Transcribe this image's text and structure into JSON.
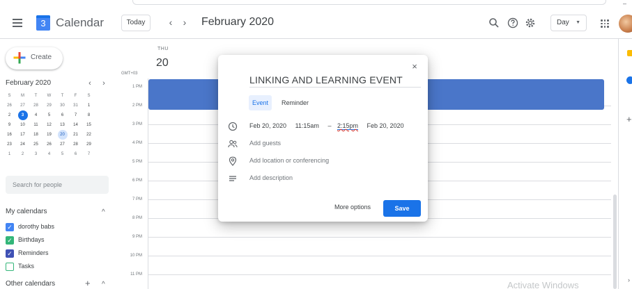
{
  "header": {
    "logo_day": "3",
    "app_title": "Calendar",
    "today_label": "Today",
    "prev_glyph": "‹",
    "next_glyph": "›",
    "date_title": "February 2020",
    "view_label": "Day",
    "view_caret": "▼",
    "icons": [
      "menu-icon",
      "search-icon",
      "help-icon",
      "gear-icon",
      "apps-icon",
      "avatar"
    ]
  },
  "sidebar": {
    "create_label": "Create",
    "mini_month": "February 2020",
    "mini_prev": "‹",
    "mini_next": "›",
    "weekday_heads": [
      "S",
      "M",
      "T",
      "W",
      "T",
      "F",
      "S"
    ],
    "weeks": [
      [
        "26",
        "27",
        "28",
        "29",
        "30",
        "31",
        "1"
      ],
      [
        "2",
        "3",
        "4",
        "5",
        "6",
        "7",
        "8"
      ],
      [
        "9",
        "10",
        "11",
        "12",
        "13",
        "14",
        "15"
      ],
      [
        "16",
        "17",
        "18",
        "19",
        "20",
        "21",
        "22"
      ],
      [
        "23",
        "24",
        "25",
        "26",
        "27",
        "28",
        "29"
      ],
      [
        "1",
        "2",
        "3",
        "4",
        "5",
        "6",
        "7"
      ]
    ],
    "today_date": "3",
    "selected_date": "20",
    "search_people_placeholder": "Search for people",
    "my_calendars_label": "My calendars",
    "my_calendars": [
      {
        "name": "dorothy babs",
        "checked": true,
        "color": "#4285f4"
      },
      {
        "name": "Birthdays",
        "checked": true,
        "color": "#33b679"
      },
      {
        "name": "Reminders",
        "checked": true,
        "color": "#3f51b5"
      },
      {
        "name": "Tasks",
        "checked": false,
        "color": "#33b679"
      }
    ],
    "other_calendars_label": "Other calendars",
    "other_plus": "+",
    "caret_up": "^"
  },
  "day_view": {
    "weekday": "THU",
    "day_number": "20",
    "timezone": "GMT+03",
    "hours": [
      "1 PM",
      "2 PM",
      "3 PM",
      "4 PM",
      "5 PM",
      "6 PM",
      "7 PM",
      "8 PM",
      "9 PM",
      "10 PM",
      "11 PM"
    ],
    "event_color": "#4a76c9"
  },
  "dialog": {
    "close_glyph": "×",
    "title": "LINKING AND LEARNING EVENT",
    "tab_event": "Event",
    "tab_reminder": "Reminder",
    "start_date": "Feb 20, 2020",
    "start_time": "11:15am",
    "dash": "–",
    "end_time": "2:15pm",
    "end_date": "Feb 20, 2020",
    "guests_placeholder": "Add guests",
    "location_placeholder": "Add location or conferencing",
    "description_placeholder": "Add description",
    "more_options_label": "More options",
    "save_label": "Save"
  },
  "watermark": "Activate Windows",
  "colors": {
    "accent": "#1a73e8",
    "event": "#4a76c9",
    "reminders": "#3f51b5",
    "birthdays": "#33b679"
  }
}
